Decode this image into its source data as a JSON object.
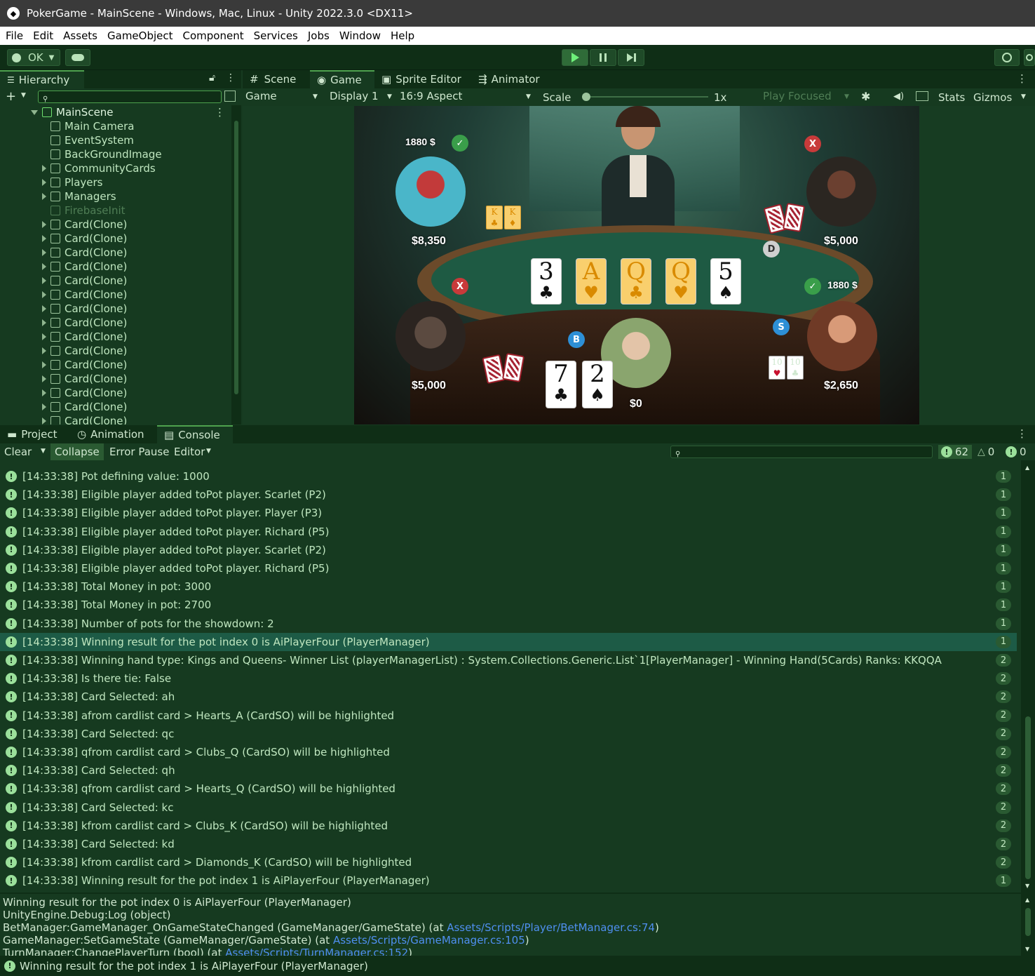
{
  "window": {
    "title": "PokerGame - MainScene - Windows, Mac, Linux - Unity 2022.3.0 <DX11>"
  },
  "menu": [
    "File",
    "Edit",
    "Assets",
    "GameObject",
    "Component",
    "Services",
    "Jobs",
    "Window",
    "Help"
  ],
  "toolbar": {
    "account_label": "OK"
  },
  "hierarchy": {
    "tab_label": "Hierarchy",
    "scene_name": "MainScene",
    "items": [
      {
        "label": "Main Camera",
        "expandable": false,
        "disabled": false
      },
      {
        "label": "EventSystem",
        "expandable": false,
        "disabled": false
      },
      {
        "label": "BackGroundImage",
        "expandable": false,
        "disabled": false
      },
      {
        "label": "CommunityCards",
        "expandable": true,
        "disabled": false
      },
      {
        "label": "Players",
        "expandable": true,
        "disabled": false
      },
      {
        "label": "Managers",
        "expandable": true,
        "disabled": false
      },
      {
        "label": "FirebaseInit",
        "expandable": false,
        "disabled": true
      },
      {
        "label": "Card(Clone)",
        "expandable": true,
        "disabled": false
      },
      {
        "label": "Card(Clone)",
        "expandable": true,
        "disabled": false
      },
      {
        "label": "Card(Clone)",
        "expandable": true,
        "disabled": false
      },
      {
        "label": "Card(Clone)",
        "expandable": true,
        "disabled": false
      },
      {
        "label": "Card(Clone)",
        "expandable": true,
        "disabled": false
      },
      {
        "label": "Card(Clone)",
        "expandable": true,
        "disabled": false
      },
      {
        "label": "Card(Clone)",
        "expandable": true,
        "disabled": false
      },
      {
        "label": "Card(Clone)",
        "expandable": true,
        "disabled": false
      },
      {
        "label": "Card(Clone)",
        "expandable": true,
        "disabled": false
      },
      {
        "label": "Card(Clone)",
        "expandable": true,
        "disabled": false
      },
      {
        "label": "Card(Clone)",
        "expandable": true,
        "disabled": false
      },
      {
        "label": "Card(Clone)",
        "expandable": true,
        "disabled": false
      },
      {
        "label": "Card(Clone)",
        "expandable": true,
        "disabled": false
      },
      {
        "label": "Card(Clone)",
        "expandable": true,
        "disabled": false
      },
      {
        "label": "Card(Clone)",
        "expandable": true,
        "disabled": false
      },
      {
        "label": "Card(Clone)",
        "expandable": true,
        "disabled": false
      },
      {
        "label": "Card(Clone)",
        "expandable": true,
        "disabled": false
      }
    ]
  },
  "view_tabs": [
    "Scene",
    "Game",
    "Sprite Editor",
    "Animator"
  ],
  "game_toolbar": {
    "mode": "Game",
    "display": "Display 1",
    "aspect": "16:9 Aspect",
    "scale_label": "Scale",
    "scale_value": "1x",
    "play_focused": "Play Focused",
    "stats": "Stats",
    "gizmos": "Gizmos"
  },
  "game": {
    "community_cards": [
      {
        "rank": "3",
        "suit": "♣",
        "highlight": false
      },
      {
        "rank": "A",
        "suit": "♥",
        "highlight": true
      },
      {
        "rank": "Q",
        "suit": "♣",
        "highlight": true
      },
      {
        "rank": "Q",
        "suit": "♥",
        "highlight": true
      },
      {
        "rank": "5",
        "suit": "♠",
        "highlight": false
      }
    ],
    "players": {
      "top_left_bet": "1880 $",
      "top_left_money": "$8,350",
      "top_right_money": "$5,000",
      "right_bet": "1880 $",
      "right_money": "$2,650",
      "bottom_left_money": "$5,000",
      "bottom_money": "$0"
    },
    "top_left_cards": [
      {
        "rank": "K",
        "suit": "♣"
      },
      {
        "rank": "K",
        "suit": "♦"
      }
    ],
    "right_cards": [
      {
        "rank": "10",
        "suit": "♥"
      },
      {
        "rank": "10",
        "suit": "♣"
      }
    ],
    "player_cards": [
      {
        "rank": "7",
        "suit": "♣"
      },
      {
        "rank": "2",
        "suit": "♠"
      }
    ],
    "chips": {
      "dealer": "D",
      "big": "B",
      "small": "S"
    },
    "marks": {
      "check": "✓",
      "fold": "X"
    }
  },
  "bottom_tabs": [
    "Project",
    "Animation",
    "Console"
  ],
  "console_toolbar": {
    "clear": "Clear",
    "collapse": "Collapse",
    "error_pause": "Error Pause",
    "editor": "Editor",
    "info_count": "62",
    "warn_count": "0",
    "error_count": "0"
  },
  "console": {
    "rows": [
      {
        "text": "[14:33:38] Pot defining value: 1000",
        "count": "1",
        "selected": false
      },
      {
        "text": "[14:33:38] Eligible player added toPot player. Scarlet (P2)",
        "count": "1",
        "selected": false
      },
      {
        "text": "[14:33:38] Eligible player added toPot player. Player (P3)",
        "count": "1",
        "selected": false
      },
      {
        "text": "[14:33:38] Eligible player added toPot player. Richard (P5)",
        "count": "1",
        "selected": false
      },
      {
        "text": "[14:33:38] Eligible player added toPot player. Scarlet (P2)",
        "count": "1",
        "selected": false
      },
      {
        "text": "[14:33:38] Eligible player added toPot player. Richard (P5)",
        "count": "1",
        "selected": false
      },
      {
        "text": "[14:33:38] Total Money in pot: 3000",
        "count": "1",
        "selected": false
      },
      {
        "text": "[14:33:38] Total Money in pot: 2700",
        "count": "1",
        "selected": false
      },
      {
        "text": "[14:33:38] Number of pots for the showdown: 2",
        "count": "1",
        "selected": false
      },
      {
        "text": "[14:33:38] Winning result for the pot index 0 is AiPlayerFour (PlayerManager)",
        "count": "1",
        "selected": true
      },
      {
        "text": "[14:33:38] Winning hand type: Kings and Queens- Winner List (playerManagerList) : System.Collections.Generic.List`1[PlayerManager] - Winning Hand(5Cards) Ranks: KKQQA",
        "count": "2",
        "selected": false
      },
      {
        "text": "[14:33:38] Is there tie: False",
        "count": "2",
        "selected": false
      },
      {
        "text": "[14:33:38] Card Selected: ah",
        "count": "2",
        "selected": false
      },
      {
        "text": "[14:33:38] afrom cardlist card > Hearts_A (CardSO)  will be highlighted",
        "count": "2",
        "selected": false
      },
      {
        "text": "[14:33:38] Card Selected: qc",
        "count": "2",
        "selected": false
      },
      {
        "text": "[14:33:38] qfrom cardlist card > Clubs_Q (CardSO)  will be highlighted",
        "count": "2",
        "selected": false
      },
      {
        "text": "[14:33:38] Card Selected: qh",
        "count": "2",
        "selected": false
      },
      {
        "text": "[14:33:38] qfrom cardlist card > Hearts_Q (CardSO)  will be highlighted",
        "count": "2",
        "selected": false
      },
      {
        "text": "[14:33:38] Card Selected: kc",
        "count": "2",
        "selected": false
      },
      {
        "text": "[14:33:38] kfrom cardlist card > Clubs_K (CardSO)  will be highlighted",
        "count": "2",
        "selected": false
      },
      {
        "text": "[14:33:38] Card Selected: kd",
        "count": "2",
        "selected": false
      },
      {
        "text": "[14:33:38] kfrom cardlist card > Diamonds_K (CardSO)  will be highlighted",
        "count": "2",
        "selected": false
      },
      {
        "text": "[14:33:38] Winning result for the pot index 1 is AiPlayerFour (PlayerManager)",
        "count": "1",
        "selected": false
      }
    ],
    "detail": [
      {
        "text": "Winning result for the pot index 0 is AiPlayerFour (PlayerManager)",
        "link": "",
        "suffix": ""
      },
      {
        "text": "UnityEngine.Debug:Log (object)",
        "link": "",
        "suffix": ""
      },
      {
        "text": "BetManager:GameManager_OnGameStateChanged (GameManager/GameState) (at ",
        "link": "Assets/Scripts/Player/BetManager.cs:74",
        "suffix": ")"
      },
      {
        "text": "GameManager:SetGameState (GameManager/GameState) (at ",
        "link": "Assets/Scripts/GameManager.cs:105",
        "suffix": ")"
      },
      {
        "text": "TurnManager:ChangePlayerTurn (bool) (at ",
        "link": "Assets/Scripts/TurnManager.cs:152",
        "suffix": ")"
      }
    ],
    "status": "Winning result for the pot index 1 is AiPlayerFour (PlayerManager)"
  }
}
